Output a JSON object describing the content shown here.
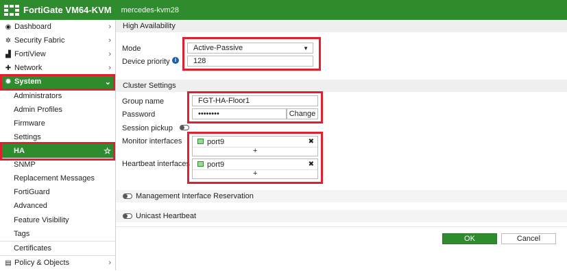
{
  "topbar": {
    "app_title": "FortiGate VM64-KVM",
    "hostname": "mercedes-kvm28"
  },
  "sidebar": {
    "dashboard": "Dashboard",
    "security_fabric": "Security Fabric",
    "fortiview": "FortiView",
    "network": "Network",
    "system": "System",
    "sub": {
      "administrators": "Administrators",
      "admin_profiles": "Admin Profiles",
      "firmware": "Firmware",
      "settings": "Settings",
      "ha": "HA",
      "snmp": "SNMP",
      "replacement_messages": "Replacement Messages",
      "fortiguard": "FortiGuard",
      "advanced": "Advanced",
      "feature_visibility": "Feature Visibility",
      "tags": "Tags",
      "certificates": "Certificates"
    },
    "policy_objects": "Policy & Objects"
  },
  "main": {
    "ha_header": "High Availability",
    "mode_label": "Mode",
    "mode_value": "Active-Passive",
    "device_priority_label": "Device priority",
    "device_priority_value": "128",
    "cluster_header": "Cluster Settings",
    "group_name_label": "Group name",
    "group_name_value": "FGT-HA-Floor1",
    "password_label": "Password",
    "password_value": "••••••••",
    "change_button": "Change",
    "session_pickup_label": "Session pickup",
    "monitor_label": "Monitor interfaces",
    "monitor_port": "port9",
    "heartbeat_label": "Heartbeat interfaces",
    "heartbeat_port": "port9",
    "plus": "+",
    "remove": "✖",
    "mgmt_reservation": "Management Interface Reservation",
    "unicast_heartbeat": "Unicast Heartbeat",
    "ok_button": "OK",
    "cancel_button": "Cancel"
  },
  "colors": {
    "brand_green": "#2e8b2e",
    "highlight_red": "#e0202e"
  }
}
